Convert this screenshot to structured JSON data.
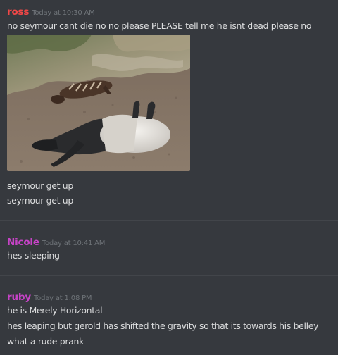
{
  "messages": [
    {
      "username": "ross",
      "username_color": "#f04747",
      "timestamp": "Today at 10:30 AM",
      "lines": [
        "no seymour cant die no no please PLEASE tell me he isnt dead please no",
        "seymour get up",
        "seymour get up"
      ],
      "attachment": "photo of a baby tapir lying behind an adult tapir lying on its side on dirt ground"
    },
    {
      "username": "Nicole",
      "username_color": "#c643c6",
      "timestamp": "Today at 10:41 AM",
      "lines": [
        "hes sleeping"
      ]
    },
    {
      "username": "ruby",
      "username_color": "#c643c6",
      "timestamp": "Today at 1:08 PM",
      "lines": [
        "he is Merely Horizontal",
        "hes leaping but gerold has shifted the gravity so that its towards his belley",
        "what a rude prank"
      ]
    }
  ]
}
